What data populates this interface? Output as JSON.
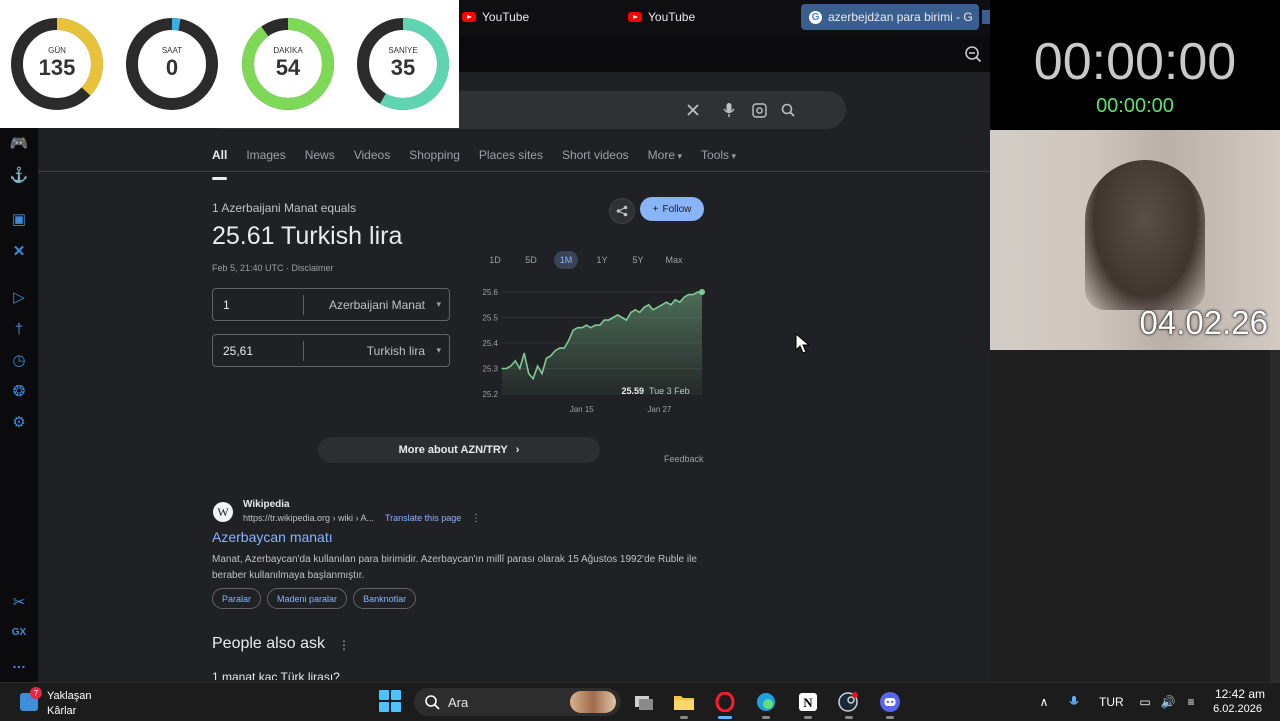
{
  "browser": {
    "tabs": [
      {
        "label": "YouTube"
      },
      {
        "label": "YouTube"
      },
      {
        "label": "azerbejdżan para birimi - G"
      }
    ]
  },
  "countdown": {
    "gauges": [
      {
        "label": "GÜN",
        "value": "135",
        "fraction": 0.37,
        "color": "#e8c33a"
      },
      {
        "label": "SAAT",
        "value": "0",
        "fraction": 0.03,
        "color": "#3bb0e0"
      },
      {
        "label": "DAKİKA",
        "value": "54",
        "fraction": 0.9,
        "color": "#7ed957"
      },
      {
        "label": "SANİYE",
        "value": "35",
        "fraction": 0.583,
        "color": "#5fd4b0"
      }
    ],
    "track_color": "#2b2b2b"
  },
  "timer": {
    "main": "00:00:00",
    "secondary": "00:00:00"
  },
  "webcam": {
    "date": "04.02.26"
  },
  "search": {
    "tabs": [
      {
        "label": "All",
        "active": true
      },
      {
        "label": "Images"
      },
      {
        "label": "News"
      },
      {
        "label": "Videos"
      },
      {
        "label": "Shopping"
      },
      {
        "label": "Places sites"
      },
      {
        "label": "Short videos"
      },
      {
        "label": "More",
        "dropdown": true
      },
      {
        "label": "Tools",
        "dropdown": true
      }
    ]
  },
  "converter": {
    "equals_text": "1 Azerbaijani Manat equals",
    "rate_text": "25.61 Turkish lira",
    "timestamp": "Feb 5, 21:40 UTC · Disclaimer",
    "follow_label": "Follow",
    "from_amount": "1",
    "from_currency": "Azerbaijani Manat",
    "to_amount": "25,61",
    "to_currency": "Turkish lira",
    "ranges": [
      "1D",
      "5D",
      "1M",
      "1Y",
      "5Y",
      "Max"
    ],
    "active_range": "1M",
    "more_about": "More about AZN/TRY",
    "feedback": "Feedback"
  },
  "chart_data": {
    "type": "area",
    "title": "",
    "xlabel": "",
    "ylabel": "",
    "yticks": [
      "25.6",
      "25.5",
      "25.4",
      "25.3",
      "25.2"
    ],
    "ylim": [
      25.2,
      25.6
    ],
    "xticks": [
      "Jan 15",
      "Jan 27"
    ],
    "tooltip": {
      "value": "25.59",
      "date": "Tue 3 Feb"
    },
    "values": [
      25.3,
      25.3,
      25.31,
      25.33,
      25.3,
      25.36,
      25.28,
      25.26,
      25.31,
      25.28,
      25.34,
      25.35,
      25.37,
      25.38,
      25.38,
      25.41,
      25.45,
      25.46,
      25.46,
      25.47,
      25.46,
      25.47,
      25.47,
      25.49,
      25.49,
      25.5,
      25.51,
      25.5,
      25.49,
      25.52,
      25.53,
      25.52,
      25.54,
      25.55,
      25.53,
      25.54,
      25.55,
      25.56,
      25.55,
      25.57,
      25.56,
      25.58,
      25.59,
      25.59,
      25.6,
      25.6
    ],
    "line_color": "#81c995"
  },
  "result": {
    "source": "Wikipedia",
    "url": "https://tr.wikipedia.org › wiki › A...",
    "translate": "Translate this page",
    "title": "Azerbaycan manatı",
    "snippet": "Manat, Azerbaycan'da kullanılan para birimidir. Azerbaycan'ın millî parası olarak 15 Ağustos 1992'de Ruble ile beraber kullanılmaya başlanmıştır.",
    "chips": [
      "Paralar",
      "Madeni paralar",
      "Banknotlar"
    ]
  },
  "paa": {
    "title": "People also ask",
    "first_question": "1 manat kaç Türk lirası?"
  },
  "taskbar": {
    "weather_badge": "7",
    "weather_line1": "Yaklaşan",
    "weather_line2": "Kârlar",
    "search_placeholder": "Ara",
    "language": "TUR",
    "time": "12:42 am",
    "date": "6.02.2026"
  }
}
